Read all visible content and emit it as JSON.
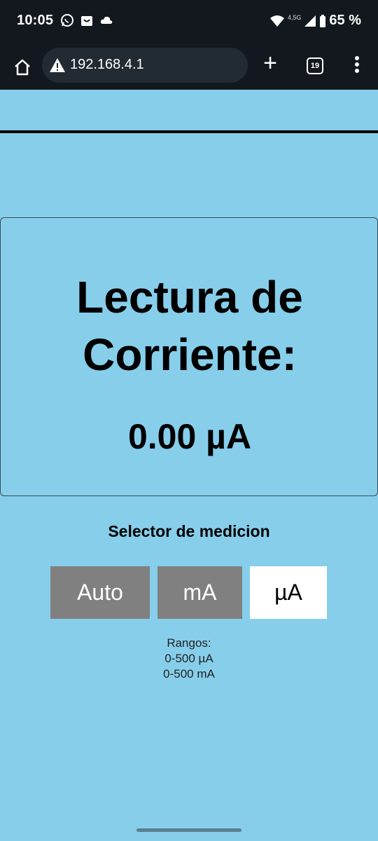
{
  "status_bar": {
    "time": "10:05",
    "network_label": "4,5G",
    "battery": "65 %",
    "icons": [
      "whatsapp-icon",
      "shopping-bag-icon",
      "cloud-icon",
      "wifi-icon",
      "signal-icon",
      "battery-icon"
    ]
  },
  "browser": {
    "url": "192.168.4.1",
    "tab_count": "19",
    "new_tab_label": "+"
  },
  "reading": {
    "title_line1": "Lectura de",
    "title_line2": "Corriente:",
    "value": "0.00 µA"
  },
  "selector": {
    "title": "Selector de medicion",
    "buttons": [
      {
        "label": "Auto",
        "selected": false
      },
      {
        "label": "mA",
        "selected": false
      },
      {
        "label": "µA",
        "selected": true
      }
    ]
  },
  "ranges": {
    "title": "Rangos:",
    "lines": [
      "0-500 µA",
      "0-500 mA"
    ]
  },
  "colors": {
    "page_background": "#87ceeb",
    "button_inactive": "#808080",
    "button_active": "#ffffff",
    "chrome_background": "#12181d"
  }
}
